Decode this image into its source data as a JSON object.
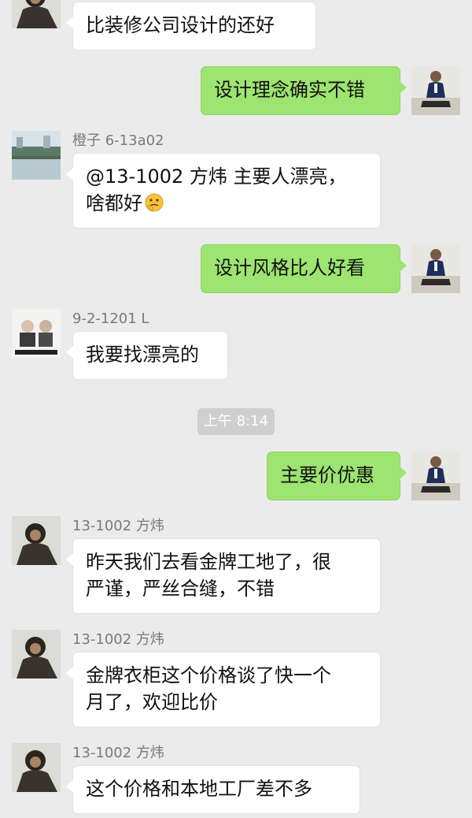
{
  "messages": [
    {
      "side": "in",
      "text": "比装修公司设计的还好"
    },
    {
      "side": "out",
      "text": "设计理念确实不错"
    },
    {
      "side": "in",
      "sender": "橙子 6-13a02",
      "lines": [
        "@13-1002  方炜 主要人漂亮，",
        "啥都好"
      ],
      "emoji": "thinking-face-emoji"
    },
    {
      "side": "out",
      "text": "设计风格比人好看"
    },
    {
      "side": "in",
      "sender": "9-2-1201 L",
      "text": "我要找漂亮的"
    },
    {
      "side": "out",
      "text": "主要价优惠"
    },
    {
      "side": "in",
      "sender": "13-1002  方炜",
      "lines": [
        "昨天我们去看金牌工地了，很",
        "严谨，严丝合缝，不错"
      ]
    },
    {
      "side": "in",
      "sender": "13-1002  方炜",
      "lines": [
        "金牌衣柜这个价格谈了快一个",
        "月了，欢迎比价"
      ]
    },
    {
      "side": "in",
      "sender": "13-1002  方炜",
      "text": "这个价格和本地工厂差不多"
    }
  ],
  "timestamp": "上午 8:14",
  "colors": {
    "background": "#ebebeb",
    "incoming_bubble": "#ffffff",
    "outgoing_bubble": "#9de471",
    "timestamp_bg": "#cfcfcf",
    "sender_name": "#7a7a7a"
  }
}
